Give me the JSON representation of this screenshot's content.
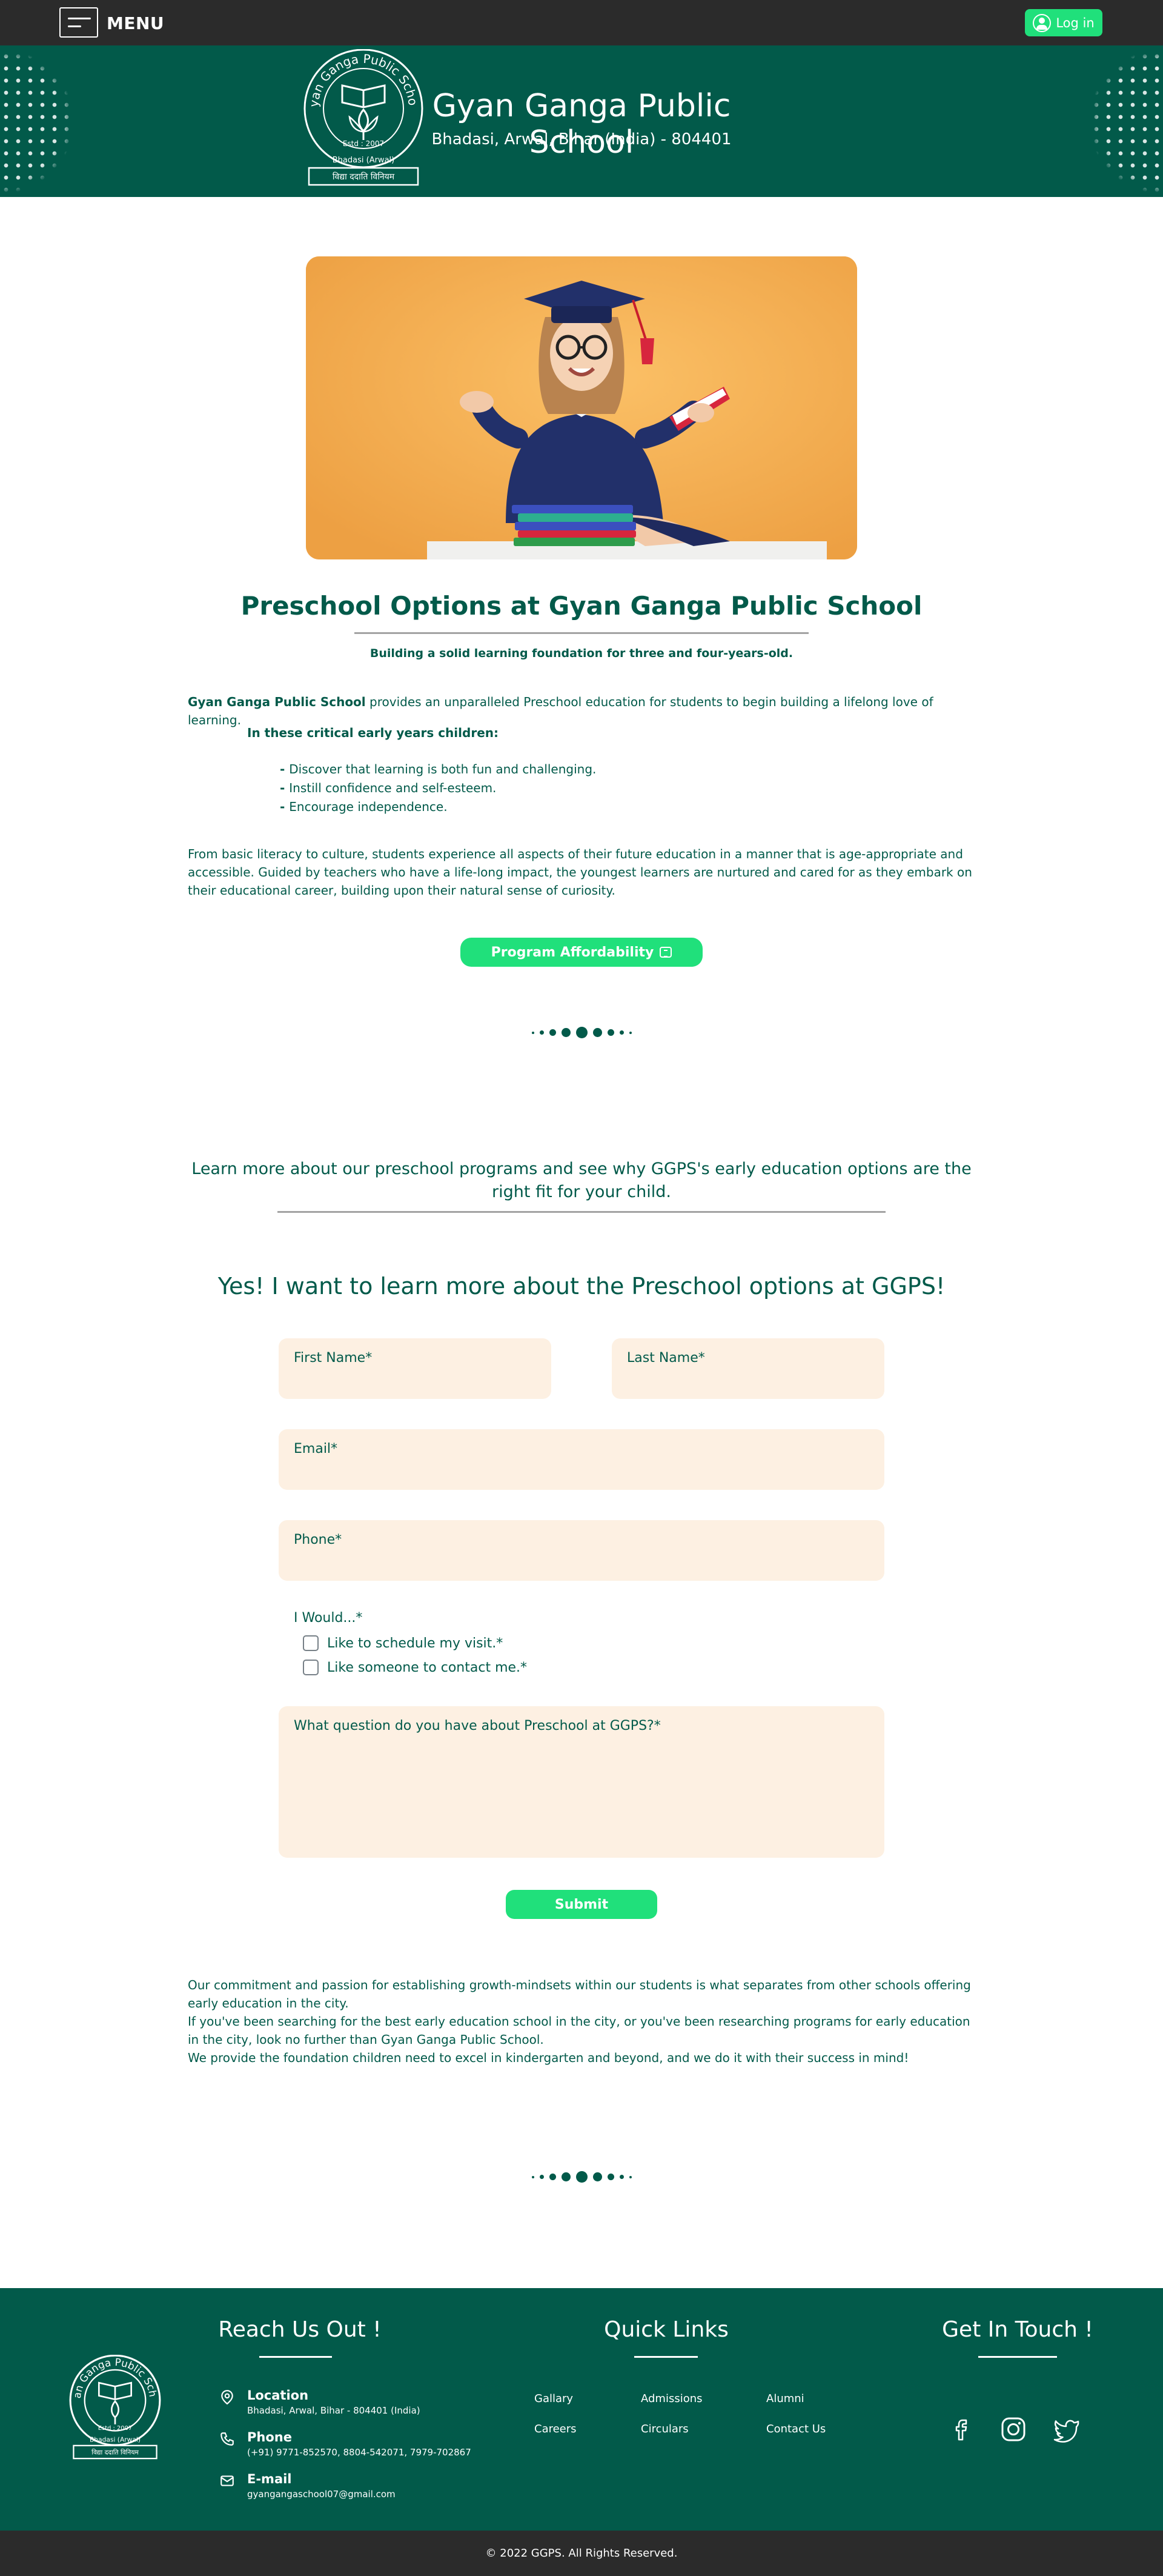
{
  "topbar": {
    "menu_label": "MENU",
    "login_label": "Log in"
  },
  "header": {
    "school_name": "Gyan Ganga Public School",
    "address": "Bhadasi, Arwal, Bihar (India) - 804401",
    "logo": {
      "ring_text": "Gyan Ganga Public School",
      "estd": "Estd : 2007",
      "place": "Bhadasi (Arwal)",
      "motto": "विद्या ददाति विनियम"
    }
  },
  "hero_image": {
    "description_icon": "graduate-girl-photo"
  },
  "main": {
    "title": "Preschool Options at Gyan Ganga Public School",
    "subtitle": "Building a solid learning foundation for three and four-years-old.",
    "intro_bold": "Gyan Ganga Public School",
    "intro_rest": " provides an unparalleled Preschool education for students to begin building a lifelong love of learning.",
    "early_heading": "In these critical early years children:",
    "bullets": [
      "Discover that learning is both fun and challenging.",
      "Instill confidence and self-esteem.",
      "Encourage independence."
    ],
    "body": "From basic literacy to culture, students experience all aspects of their future education in a manner that is age-appropriate and accessible. Guided by teachers who have a life-long impact, the youngest learners are nurtured and cared for as they embark on their educational career, building upon their natural sense of curiosity.",
    "afford_button": "Program Affordability",
    "learn_more": "Learn more about our preschool programs and see why GGPS's early education options are the right fit for your child."
  },
  "form": {
    "title": "Yes! I want to learn more about the Preschool options at GGPS!",
    "first_name": "First Name*",
    "last_name": "Last Name*",
    "email": "Email*",
    "phone": "Phone*",
    "would_label": "I Would...*",
    "option_visit": "Like to schedule my visit.*",
    "option_contact": "Like someone to contact me.*",
    "question": "What question do you have about Preschool at GGPS?*",
    "submit": "Submit"
  },
  "closing": {
    "line1": "Our commitment and passion for establishing growth-mindsets within our students is what separates from other schools offering early education in the city.",
    "line2": "If you've been searching for the best early education school in the city, or you've been researching programs for early education in the city, look no further than Gyan Ganga Public School.",
    "line3": "We provide the foundation children need to excel in kindergarten and beyond, and we do it with their success in mind!"
  },
  "footer": {
    "reach_title": "Reach Us Out !",
    "location_title": "Location",
    "location_value": "Bhadasi, Arwal, Bihar - 804401 (India)",
    "phone_title": "Phone",
    "phone_value": "(+91) 9771-852570, 8804-542071, 7979-702867",
    "email_title": "E-mail",
    "email_value": "gyangangaschool07@gmail.com",
    "quick_title": "Quick Links",
    "links": [
      "Gallary",
      "Admissions",
      "Alumni",
      "Careers",
      "Circulars",
      "Contact Us"
    ],
    "touch_title": "Get In Touch !",
    "social_icons": [
      "facebook-icon",
      "instagram-icon",
      "twitter-icon"
    ]
  },
  "copyright": "© 2022 GGPS. All Rights Reserved.",
  "colors": {
    "brand_green": "#025a4a",
    "accent_green": "#20e07b",
    "dark_bar": "#2b2b2b",
    "field_bg": "#fdf0e2"
  }
}
